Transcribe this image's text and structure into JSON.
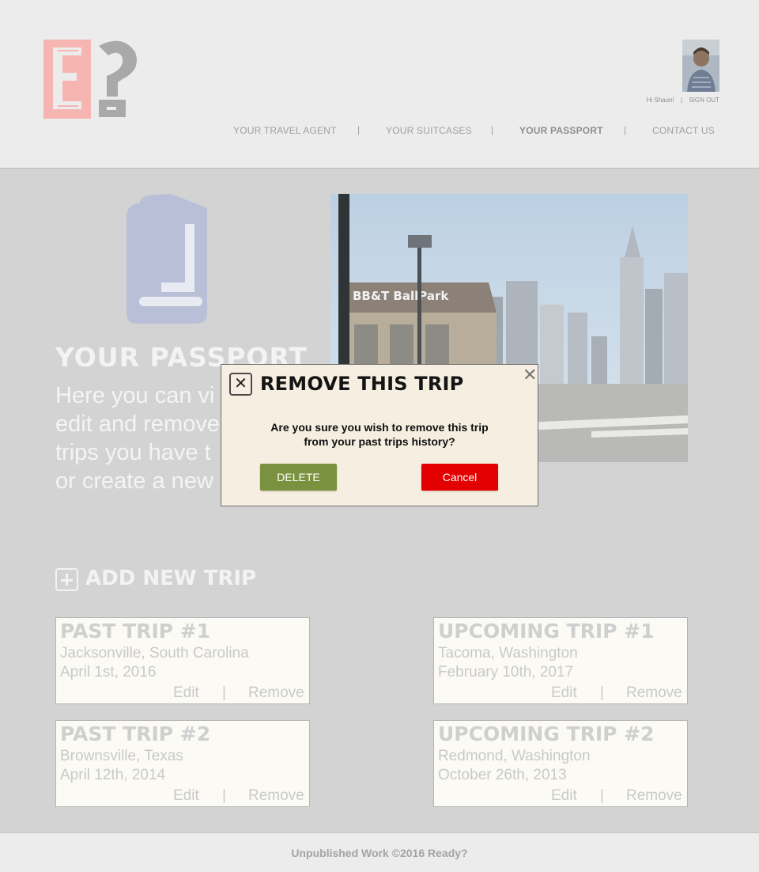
{
  "brand": {
    "logo_letter": "E",
    "logo_mark": "?"
  },
  "user": {
    "greeting": "Hi Shaun!",
    "separator": "|",
    "signout": "SIGN OUT"
  },
  "nav": {
    "items": [
      "YOUR TRAVEL AGENT",
      "YOUR SUITCASES",
      "YOUR PASSPORT",
      "CONTACT US"
    ],
    "active": "YOUR PASSPORT",
    "separator": "|"
  },
  "hero": {
    "title": "YOUR PASSPORT",
    "line1": "Here you can vi",
    "line2": "edit and remove",
    "line3": "trips you have t",
    "line4": "or create a new"
  },
  "photo": {
    "sign_text": "BB&T BallPark"
  },
  "add_trip": {
    "label": "ADD NEW TRIP"
  },
  "trips": [
    {
      "title": "PAST TRIP #1",
      "location": "Jacksonville, South Carolina",
      "date": "April 1st, 2016",
      "edit": "Edit",
      "sep": "|",
      "remove": "Remove"
    },
    {
      "title": "UPCOMING TRIP #1",
      "location": "Tacoma, Washington",
      "date": "February 10th, 2017",
      "edit": "Edit",
      "sep": "|",
      "remove": "Remove"
    },
    {
      "title": "PAST TRIP #2",
      "location": "Brownsville, Texas",
      "date": "April 12th, 2014",
      "edit": "Edit",
      "sep": "|",
      "remove": "Remove"
    },
    {
      "title": "UPCOMING TRIP #2",
      "location": "Redmond, Washington",
      "date": "October 26th, 2013",
      "edit": "Edit",
      "sep": "|",
      "remove": "Remove"
    }
  ],
  "modal": {
    "title": "REMOVE THIS TRIP",
    "close_glyph": "✕",
    "dismiss_glyph": "✕",
    "message_line1": "Are you sure you wish to remove this trip",
    "message_line2": "from your past trips history?",
    "delete_label": "DELETE",
    "cancel_label": "Cancel"
  },
  "footer": {
    "text": "Unpublished Work ©2016 Ready?"
  },
  "colors": {
    "logo_pink": "#f7b5b1",
    "logo_gray": "#a9a9a9",
    "book_blue": "#b8bfd6",
    "delete_green": "#7a913f",
    "cancel_red": "#e20000",
    "modal_bg": "#f6eee0"
  }
}
